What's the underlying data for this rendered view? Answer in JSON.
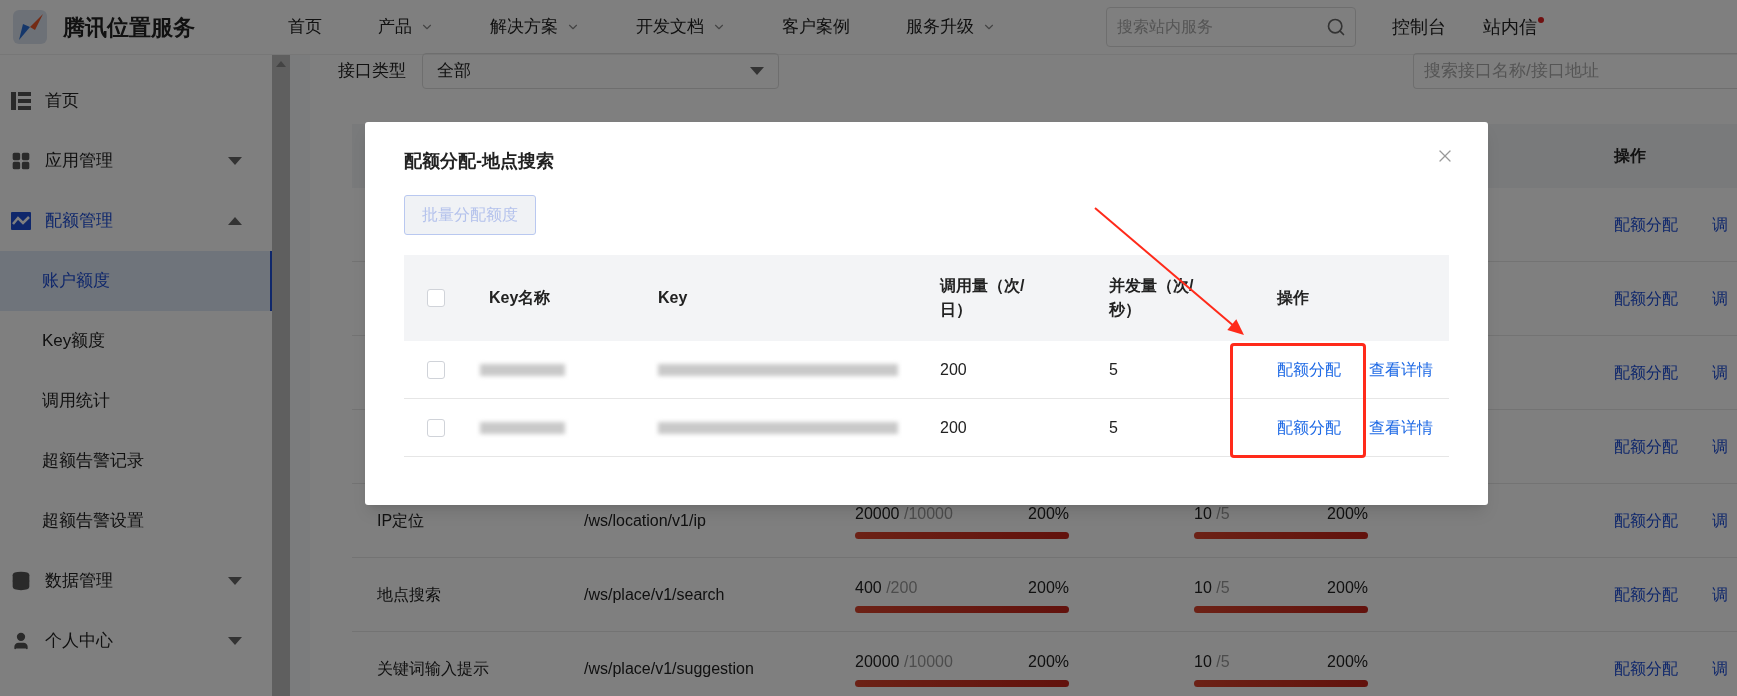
{
  "header": {
    "logo_text": "腾讯位置服务",
    "nav": [
      {
        "label": "首页",
        "dropdown": false
      },
      {
        "label": "产品",
        "dropdown": true
      },
      {
        "label": "解决方案",
        "dropdown": true
      },
      {
        "label": "开发文档",
        "dropdown": true
      },
      {
        "label": "客户案例",
        "dropdown": false
      },
      {
        "label": "服务升级",
        "dropdown": true
      }
    ],
    "search": {
      "placeholder": "搜索站内服务"
    },
    "links": [
      {
        "label": "控制台",
        "badge": false
      },
      {
        "label": "站内信",
        "badge": true
      }
    ]
  },
  "sidebar": {
    "items": [
      {
        "label": "首页",
        "selected": false
      },
      {
        "label": "应用管理",
        "selected": false,
        "expanded": false
      },
      {
        "label": "配额管理",
        "selected": true,
        "expanded": true,
        "children": [
          {
            "label": "账户额度",
            "selected": true
          },
          {
            "label": "Key额度",
            "selected": false
          },
          {
            "label": "调用统计",
            "selected": false
          },
          {
            "label": "超额告警记录",
            "selected": false
          },
          {
            "label": "超额告警设置",
            "selected": false
          }
        ]
      },
      {
        "label": "数据管理",
        "selected": false,
        "expanded": false
      },
      {
        "label": "个人中心",
        "selected": false,
        "expanded": false
      }
    ]
  },
  "filter": {
    "type_label": "接口类型",
    "type_value": "全部",
    "search": {
      "placeholder": "搜索接口名称/接口地址"
    }
  },
  "table": {
    "action_header": "操作",
    "rows": [
      {
        "actions": [
          "配额分配",
          "调"
        ]
      },
      {
        "actions": [
          "配额分配",
          "调"
        ]
      },
      {
        "actions": [
          "配额分配",
          "调"
        ]
      },
      {
        "actions": [
          "配额分配",
          "调"
        ]
      },
      {
        "name": "IP定位",
        "path": "/ws/location/v1/ip",
        "calls": {
          "used": "20000",
          "limit": "/10000",
          "percent": "200%",
          "level": 1
        },
        "concurrency": {
          "used": "10",
          "limit": "/5",
          "percent": "200%",
          "level": 1
        },
        "actions": [
          "配额分配",
          "调"
        ]
      },
      {
        "name": "地点搜索",
        "path": "/ws/place/v1/search",
        "calls": {
          "used": "400",
          "limit": "/200",
          "percent": "200%",
          "level": 1
        },
        "concurrency": {
          "used": "10",
          "limit": "/5",
          "percent": "200%",
          "level": 1
        },
        "actions": [
          "配额分配",
          "调"
        ]
      },
      {
        "name": "关键词输入提示",
        "path": "/ws/place/v1/suggestion",
        "calls": {
          "used": "20000",
          "limit": "/10000",
          "percent": "200%",
          "level": 1
        },
        "concurrency": {
          "used": "10",
          "limit": "/5",
          "percent": "200%",
          "level": 1
        },
        "actions": [
          "配额分配",
          "调"
        ]
      }
    ]
  },
  "modal": {
    "title": "配额分配-地点搜索",
    "batch_button": {
      "label": "批量分配额度",
      "disabled": true
    },
    "table": {
      "select_all_checked": false,
      "columns": [
        "Key名称",
        "Key",
        "调用量（次/日）",
        "并发量（次/秒）",
        "操作"
      ],
      "rows": [
        {
          "checked": false,
          "calls": "200",
          "concurrency": "5",
          "actions": [
            "配额分配",
            "查看详情"
          ]
        },
        {
          "checked": false,
          "calls": "200",
          "concurrency": "5",
          "actions": [
            "配额分配",
            "查看详情"
          ]
        }
      ]
    }
  }
}
